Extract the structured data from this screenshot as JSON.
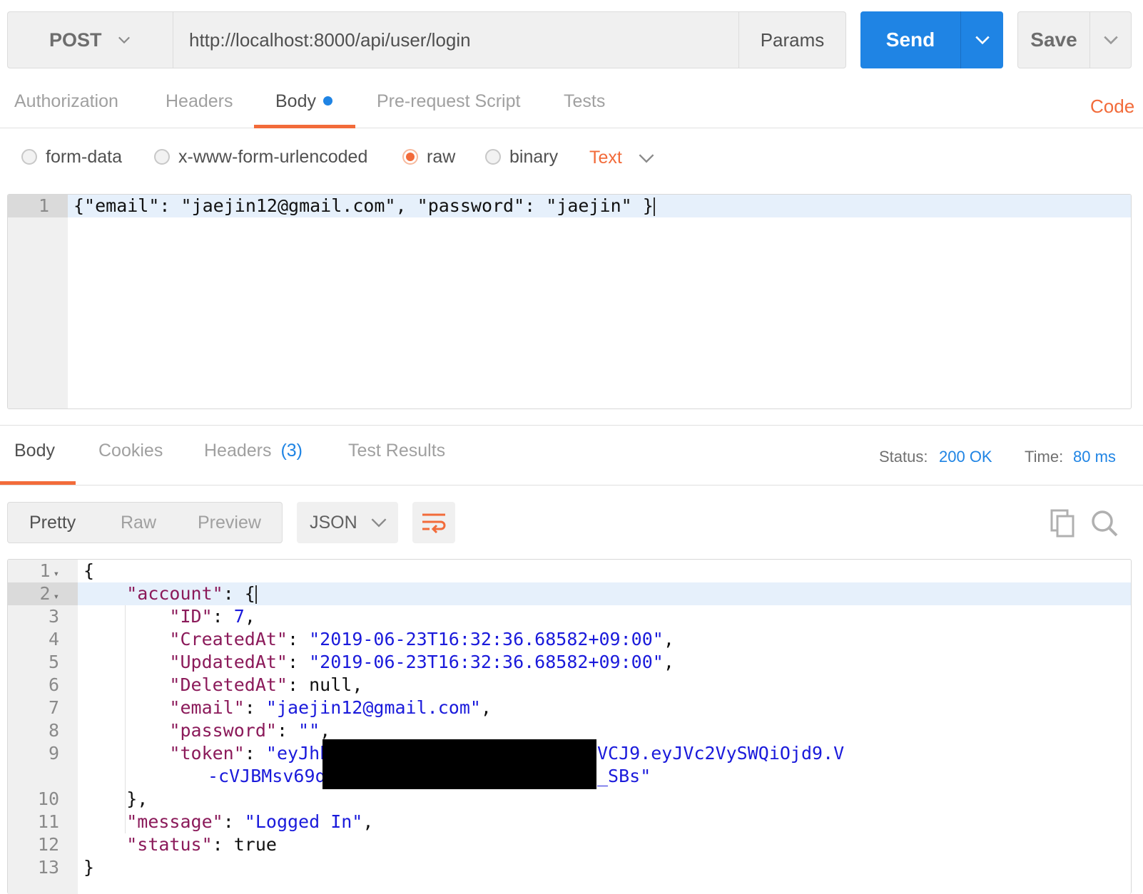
{
  "request": {
    "method": "POST",
    "url": "http://localhost:8000/api/user/login",
    "params_label": "Params",
    "send_label": "Send",
    "save_label": "Save",
    "tabs": [
      {
        "label": "Authorization"
      },
      {
        "label": "Headers"
      },
      {
        "label": "Body",
        "active": true
      },
      {
        "label": "Pre-request Script"
      },
      {
        "label": "Tests"
      }
    ],
    "code_label": "Code",
    "body_types": [
      {
        "label": "form-data",
        "checked": false
      },
      {
        "label": "x-www-form-urlencoded",
        "checked": false
      },
      {
        "label": "raw",
        "checked": true
      },
      {
        "label": "binary",
        "checked": false
      }
    ],
    "text_type": "Text",
    "body_lines": [
      {
        "n": "1",
        "text": "{\"email\": \"jaejin12@gmail.com\", \"password\": \"jaejin\" }"
      }
    ]
  },
  "response": {
    "tabs": [
      {
        "label": "Body",
        "active": true
      },
      {
        "label": "Cookies"
      },
      {
        "label": "Headers"
      },
      {
        "label": "Test Results"
      }
    ],
    "headers_count": "(3)",
    "status_label": "Status:",
    "status_value": "200 OK",
    "time_label": "Time:",
    "time_value": "80 ms",
    "view_modes": [
      {
        "label": "Pretty",
        "active": true
      },
      {
        "label": "Raw"
      },
      {
        "label": "Preview"
      }
    ],
    "format": "JSON",
    "line_numbers": [
      "1",
      "2",
      "3",
      "4",
      "5",
      "6",
      "7",
      "8",
      "9",
      "10",
      "11",
      "12",
      "13"
    ],
    "json": {
      "l1": "{",
      "k_account": "\"account\"",
      "k_id": "\"ID\"",
      "v_id": "7",
      "k_created": "\"CreatedAt\"",
      "v_created": "\"2019-06-23T16:32:36.68582+09:00\"",
      "k_updated": "\"UpdatedAt\"",
      "v_updated": "\"2019-06-23T16:32:36.68582+09:00\"",
      "k_deleted": "\"DeletedAt\"",
      "v_deleted": "null",
      "k_email": "\"email\"",
      "v_email": "\"jaejin12@gmail.com\"",
      "k_password": "\"password\"",
      "v_password": "\"\"",
      "k_token": "\"token\"",
      "v_token_a": "\"eyJhbG",
      "v_token_b": "VCJ9.eyJVc2VySWQiOjd9.V",
      "v_token_c": "-cVJBMsv69q",
      "v_token_d": "_SBs\"",
      "k_message": "\"message\"",
      "v_message": "\"Logged In\"",
      "k_status": "\"status\"",
      "v_status": "true"
    }
  },
  "colors": {
    "accent": "#f26b3a",
    "primary": "#1f84e4",
    "json_key": "#8b1a5a",
    "json_string": "#1a1adb"
  }
}
